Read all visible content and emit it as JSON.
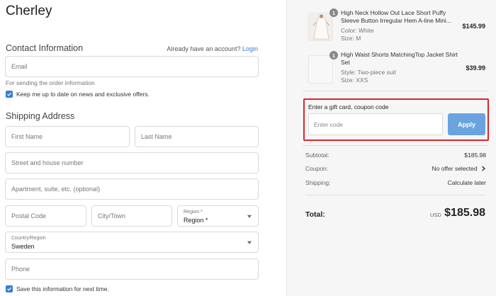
{
  "brand": "Cherley",
  "contact": {
    "title": "Contact Information",
    "account_prompt": "Already have an account?",
    "login_link": "Login",
    "email_placeholder": "Email",
    "email_hint": "For sending the order information",
    "newsletter_label": "Keep me up to date on news and exclusive offers."
  },
  "shipping": {
    "title": "Shipping Address",
    "first_name_placeholder": "First Name",
    "last_name_placeholder": "Last Name",
    "street_placeholder": "Street and house number",
    "apartment_placeholder": "Apartment, suite, etc. (optional)",
    "postal_placeholder": "Postal Code",
    "city_placeholder": "City/Town",
    "region_label": "Region",
    "region_required": "*",
    "region_value": "Region *",
    "country_label": "Country/Region",
    "country_value": "Sweden",
    "phone_placeholder": "Phone",
    "save_label": "Save this information for next time."
  },
  "cart": {
    "items": [
      {
        "quantity": "1",
        "name_line1": "High Neck Hollow Out Lace Short Puffy",
        "name_line2": "Sleeve Button Irregular Hem A-line Mini...",
        "color": "Color: White",
        "size": "Size: M",
        "price": "$145.99"
      },
      {
        "quantity": "1",
        "name_line1": "High Waist Shorts MatchingTop Jacket Shirt",
        "name_line2": "Set",
        "style": "Style: Two-piece suit",
        "size": "Size: XXS",
        "price": "$39.99"
      }
    ]
  },
  "coupon": {
    "title": "Enter a gift card, coupon code",
    "placeholder": "Enter code",
    "apply_label": "Apply"
  },
  "summary": {
    "subtotal_label": "Subtotal:",
    "subtotal_value": "$185.98",
    "coupon_label": "Coupon:",
    "coupon_value": "No offer selected",
    "shipping_label": "Shipping:",
    "shipping_value": "Calculate later",
    "total_label": "Total:",
    "currency": "USD",
    "total_value": "$185.98"
  },
  "colors": {
    "accent": "#3a7bd5",
    "apply_button": "#6ba3de",
    "highlight_border": "#d8262c"
  },
  "icons": {
    "checkbox": "check-icon",
    "select": "chevron-down-icon",
    "coupon_select": "chevron-right-icon"
  }
}
